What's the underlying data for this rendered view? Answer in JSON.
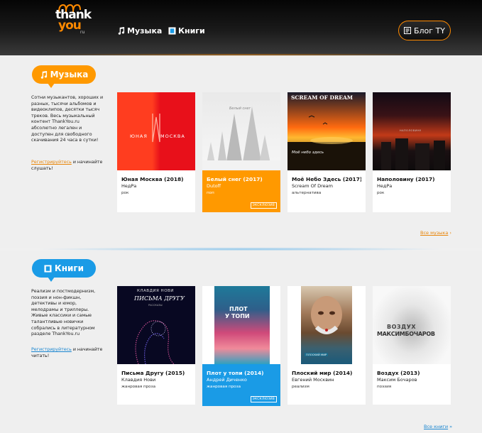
{
  "header": {
    "logo": {
      "line1": "thank",
      "line2": "you",
      "suffix": "ru"
    },
    "nav": [
      {
        "label": "Музыка",
        "icon": "music-note-icon"
      },
      {
        "label": "Книги",
        "icon": "book-icon"
      }
    ],
    "blog_button": {
      "label": "Блог TY",
      "icon": "document-icon"
    }
  },
  "music": {
    "pill": "Музыка",
    "description": "Сотни музыкантов, хороших и разных, тысячи альбомов и видеоклипов, десятки тысяч треков. Весь музыкальный контент ThankYou.ru абсолютно легален и доступен для свободного скачивания 24 часа в сутки!",
    "cta_link": "Регистрируйтесь",
    "cta_rest": " и начинайте слушать!",
    "all_link": "Все музыка",
    "all_arrow": "›",
    "items": [
      {
        "title": "Юная Москва (2018)",
        "artist": "НедРа",
        "genre": "рок",
        "highlight": false,
        "badge": ""
      },
      {
        "title": "Белый снег (2017)",
        "artist": "Dutoff",
        "genre": "поп",
        "highlight": true,
        "badge": "ЭКСКЛЮЗИВ"
      },
      {
        "title": "Моё Небо Здесь (2017)",
        "artist": "Scream Of Dream",
        "genre": "альтернатива",
        "highlight": false,
        "badge": ""
      },
      {
        "title": "Наполовину (2017)",
        "artist": "НедРа",
        "genre": "рок",
        "highlight": false,
        "badge": ""
      }
    ],
    "covers": {
      "c1_text_a": "ЮНАЯ",
      "c1_text_b": "МОСКВА",
      "c2_text": "Белый снег",
      "c3_top": "SCREAM OF DREAM",
      "c3_bottom": "Моё небо здесь",
      "c4_text": "НАПОЛОВИНУ"
    }
  },
  "books": {
    "pill": "Книги",
    "description": "Реализм и постмодернизм, поэзия и нон-фикшн, детективы и юмор, мелодрамы и триллеры. Живые классики и самые талантливые новички собрались в литературном разделе ThankYou.ru",
    "cta_link": "Регистрируйтесь",
    "cta_rest": " и начинайте читать!",
    "all_link": "Все книги",
    "all_arrow": "»",
    "items": [
      {
        "title": "Письма Другу (2015)",
        "artist": "Клавдия Нови",
        "genre": "жанровая проза",
        "highlight": false,
        "badge": ""
      },
      {
        "title": "Плот у топи (2014)",
        "artist": "Андрей Диченко",
        "genre": "жанровая проза",
        "highlight": true,
        "badge": "ЭКСКЛЮЗИВ"
      },
      {
        "title": "Плоский мир (2014)",
        "artist": "Евгений Москвин",
        "genre": "реализм",
        "highlight": false,
        "badge": ""
      },
      {
        "title": "Воздух (2013)",
        "artist": "Максим Бочаров",
        "genre": "поэзия",
        "highlight": false,
        "badge": ""
      }
    ],
    "covers": {
      "c1_author": "КЛАВДИЯ НОВИ",
      "c1_title": "ПИСЬМА ДРУГУ",
      "c1_sub": "РАССКАЗЫ",
      "c2_title_a": "ПЛОТ",
      "c2_title_b": "У ТОПИ",
      "c3_title": "ПЛОСКИЙ МИР",
      "c4_title_a": "ВОЗДУХ",
      "c4_title_b": "МАКСИМБОЧАРОВ"
    }
  },
  "colors": {
    "orange": "#ff9900",
    "blue": "#1a9be6",
    "header": "#111111"
  }
}
